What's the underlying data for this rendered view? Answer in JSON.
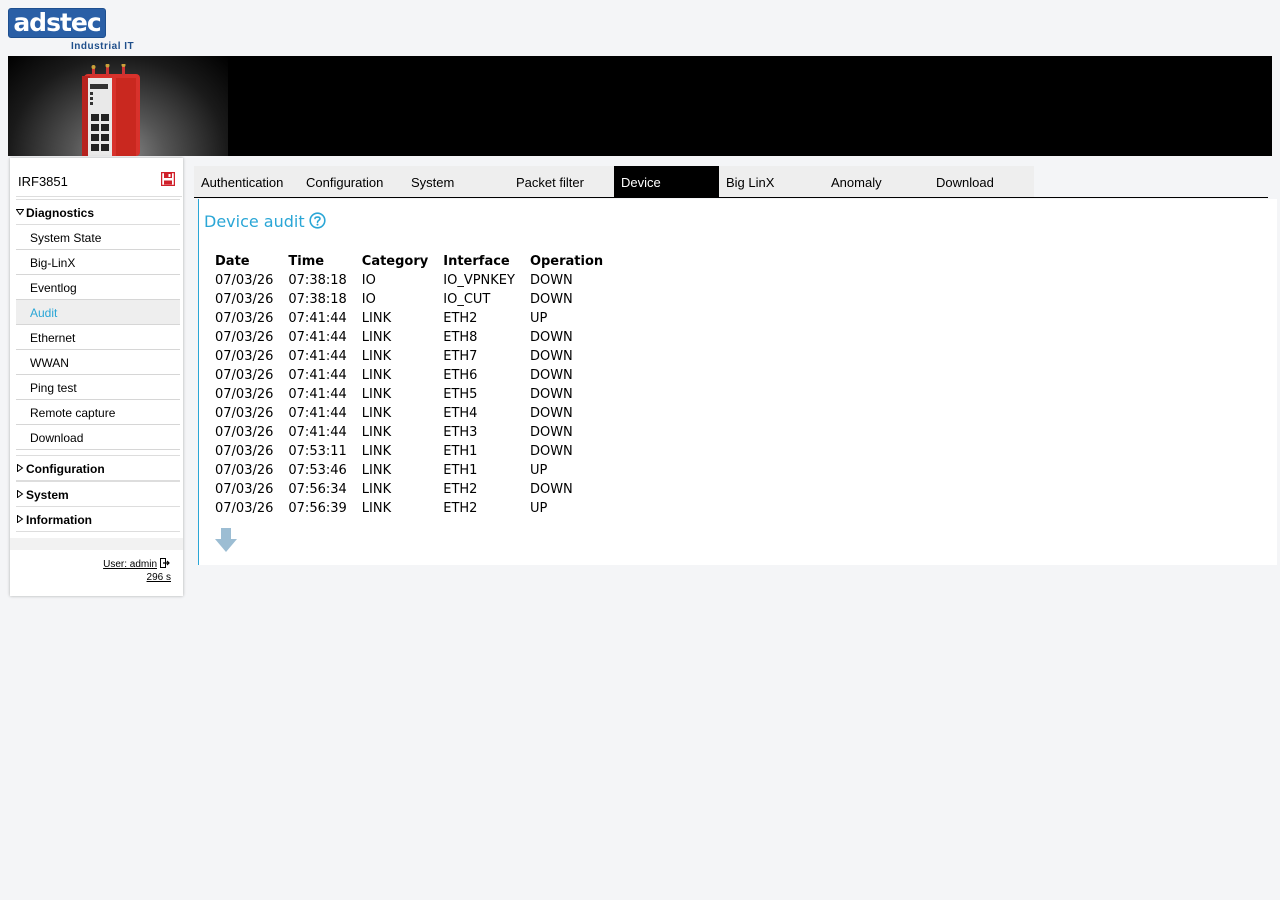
{
  "logo": {
    "brand": "adstec",
    "tagline": "Industrial IT"
  },
  "banner": {
    "image": "router-device-image"
  },
  "sidebar": {
    "device_name": "IRF3851",
    "save_icon": "save-icon",
    "sections": [
      {
        "label": "Diagnostics",
        "expanded": true,
        "items": [
          "System State",
          "Big-LinX",
          "Eventlog",
          "Audit",
          "Ethernet",
          "WWAN",
          "Ping test",
          "Remote capture",
          "Download"
        ],
        "active": "Audit"
      },
      {
        "label": "Configuration",
        "expanded": false
      },
      {
        "label": "System",
        "expanded": false
      },
      {
        "label": "Information",
        "expanded": false
      }
    ],
    "footer": {
      "user": "User: admin",
      "timer": "296 s"
    }
  },
  "tabs": {
    "items": [
      "Authentication",
      "Configuration",
      "System",
      "Packet filter",
      "Device",
      "Big LinX",
      "Anomaly",
      "Download"
    ],
    "active": "Device"
  },
  "content": {
    "title": "Device audit",
    "columns": [
      "Date",
      "Time",
      "Category",
      "Interface",
      "Operation"
    ],
    "rows": [
      [
        "07/03/26",
        "07:38:18",
        "IO",
        "IO_VPNKEY",
        "DOWN"
      ],
      [
        "07/03/26",
        "07:38:18",
        "IO",
        "IO_CUT",
        "DOWN"
      ],
      [
        "07/03/26",
        "07:41:44",
        "LINK",
        "ETH2",
        "UP"
      ],
      [
        "07/03/26",
        "07:41:44",
        "LINK",
        "ETH8",
        "DOWN"
      ],
      [
        "07/03/26",
        "07:41:44",
        "LINK",
        "ETH7",
        "DOWN"
      ],
      [
        "07/03/26",
        "07:41:44",
        "LINK",
        "ETH6",
        "DOWN"
      ],
      [
        "07/03/26",
        "07:41:44",
        "LINK",
        "ETH5",
        "DOWN"
      ],
      [
        "07/03/26",
        "07:41:44",
        "LINK",
        "ETH4",
        "DOWN"
      ],
      [
        "07/03/26",
        "07:41:44",
        "LINK",
        "ETH3",
        "DOWN"
      ],
      [
        "07/03/26",
        "07:53:11",
        "LINK",
        "ETH1",
        "DOWN"
      ],
      [
        "07/03/26",
        "07:53:46",
        "LINK",
        "ETH1",
        "UP"
      ],
      [
        "07/03/26",
        "07:56:34",
        "LINK",
        "ETH2",
        "DOWN"
      ],
      [
        "07/03/26",
        "07:56:39",
        "LINK",
        "ETH2",
        "UP"
      ]
    ]
  },
  "colors": {
    "accent": "#2aa6d6",
    "active_tab_bg": "#000000",
    "save_red": "#d0202a"
  }
}
